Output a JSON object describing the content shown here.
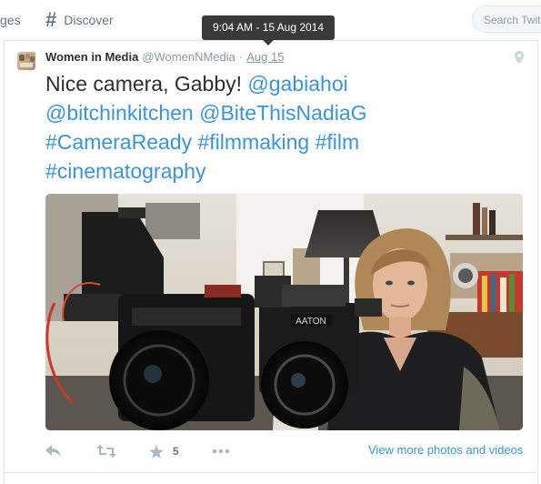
{
  "topbar": {
    "prev_nav_label": "ges",
    "discover_icon": "#",
    "discover_label": "Discover",
    "search_placeholder": "Search Twitt"
  },
  "tooltip": {
    "text": "9:04 AM - 15 Aug 2014"
  },
  "tweet": {
    "author_name": "Women in Media",
    "author_handle": "@WomenNMedia",
    "separator": "·",
    "timestamp": "Aug 15",
    "text_plain_1": "Nice camera, Gabby! ",
    "mention_1": "@gabiahoi",
    "mention_2": "@bitchinkitchen",
    "mention_3": "@BiteThisNadiaG",
    "hashtag_1": "#CameraReady",
    "hashtag_2": "#filmmaking",
    "hashtag_3": "#film",
    "hashtag_4": "#cinematography",
    "media_label_on_camera": "AATON",
    "favorite_count": "5",
    "view_more_label": "View more photos and videos"
  },
  "icons": {
    "location": "location-pin-icon",
    "reply": "reply-icon",
    "retweet": "retweet-icon",
    "favorite": "star-icon",
    "more": "more-icon"
  },
  "colors": {
    "link": "#3b94d9",
    "text": "#292f33",
    "muted": "#8899a6",
    "action_icon": "#aab8c2",
    "tooltip_bg": "#39393a"
  }
}
